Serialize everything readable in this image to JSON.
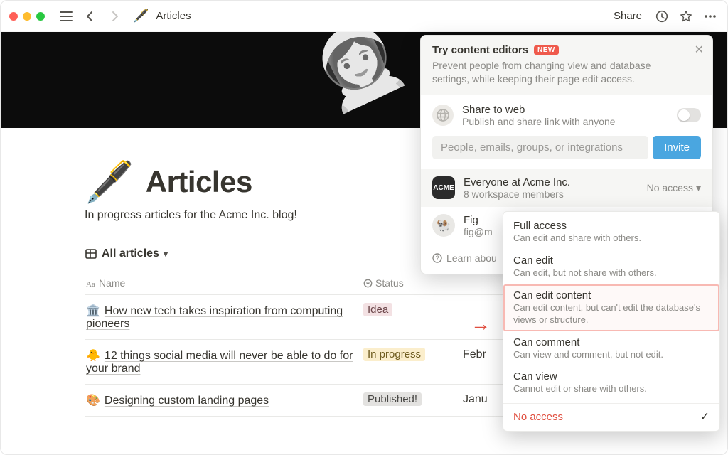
{
  "topbar": {
    "breadcrumb_icon": "🖋️",
    "breadcrumb_title": "Articles",
    "share_label": "Share"
  },
  "page": {
    "icon": "🖋️",
    "title": "Articles",
    "description": "In progress articles for the Acme Inc. blog!"
  },
  "view": {
    "label": "All articles"
  },
  "columns": {
    "name": "Name",
    "status": "Status"
  },
  "rows": [
    {
      "emoji": "🏛️",
      "name": "How new tech takes inspiration from computing pioneers",
      "status": "Idea",
      "status_class": "idea",
      "date": ""
    },
    {
      "emoji": "🐥",
      "name": "12 things social media will never be able to do for your brand",
      "status": "In progress",
      "status_class": "inprog",
      "date": "Febr"
    },
    {
      "emoji": "🎨",
      "name": "Designing custom landing pages",
      "status": "Published!",
      "status_class": "pub",
      "date": "Janu"
    }
  ],
  "panel": {
    "banner_title": "Try content editors",
    "banner_badge": "NEW",
    "banner_desc": "Prevent people from changing view and database settings, while keeping their page edit access.",
    "share_web_title": "Share to web",
    "share_web_sub": "Publish and share link with anyone",
    "invite_placeholder": "People, emails, groups, or integrations",
    "invite_button": "Invite",
    "members": [
      {
        "name": "Everyone at Acme Inc.",
        "sub": "8 workspace members",
        "perm": "No access",
        "avatar": "ACME",
        "avclass": "acme"
      },
      {
        "name": "Fig",
        "sub": "fig@m",
        "perm": "",
        "avatar": "🐏",
        "avclass": "fig"
      }
    ],
    "learn": "Learn abou"
  },
  "dropdown": [
    {
      "title": "Full access",
      "sub": "Can edit and share with others."
    },
    {
      "title": "Can edit",
      "sub": "Can edit, but not share with others."
    },
    {
      "title": "Can edit content",
      "sub": "Can edit content, but can't edit the database's views or structure.",
      "highlight": true
    },
    {
      "title": "Can comment",
      "sub": "Can view and comment, but not edit."
    },
    {
      "title": "Can view",
      "sub": "Cannot edit or share with others."
    },
    {
      "title": "No access",
      "sub": "",
      "noaccess": true,
      "checked": true
    }
  ]
}
